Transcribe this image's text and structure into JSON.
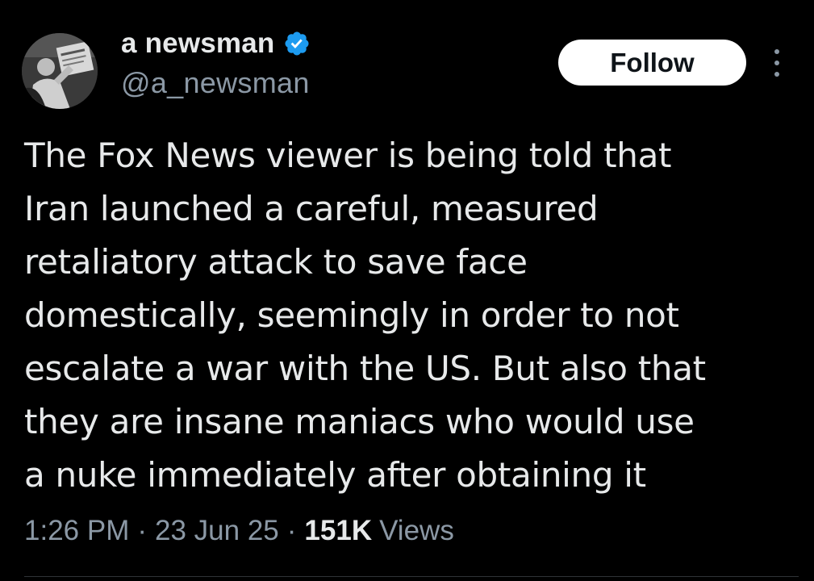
{
  "author": {
    "display_name": "a newsman",
    "handle": "@a_newsman",
    "verified": true,
    "avatar_icon": "avatar-photo"
  },
  "actions": {
    "follow_label": "Follow",
    "more_icon": "more-options-icon"
  },
  "tweet": {
    "lines": [
      "The Fox News viewer is being told that",
      "Iran launched a careful, measured",
      "retaliatory attack to save face",
      "domestically, seemingly in order to not",
      "escalate a war with the US. But also that",
      "they are insane maniacs who would use",
      "a nuke immediately after obtaining it"
    ]
  },
  "meta": {
    "time": "1:26 PM",
    "date": "23 Jun 25",
    "separator": "·",
    "views_count": "151K",
    "views_label": "Views"
  },
  "colors": {
    "background": "#000000",
    "text": "#e7e9ea",
    "secondary": "#8b98a5",
    "verified": "#1d9bf0",
    "button_bg": "#ffffff"
  }
}
